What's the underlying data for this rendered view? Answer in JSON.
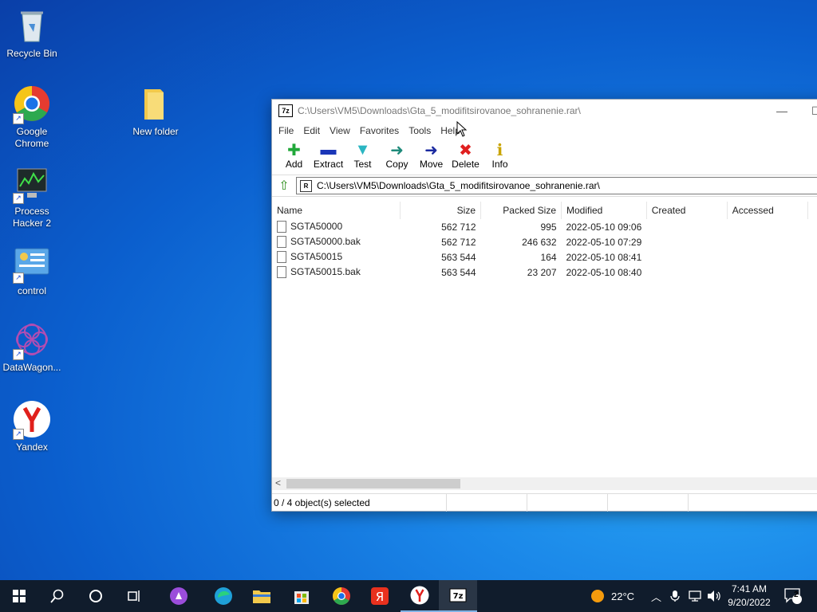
{
  "desktop": {
    "icons": [
      {
        "label": "Recycle Bin"
      },
      {
        "label": "Google Chrome"
      },
      {
        "label": "New folder"
      },
      {
        "label": "Process Hacker 2"
      },
      {
        "label": "control"
      },
      {
        "label": "DataWagon..."
      },
      {
        "label": "Yandex"
      }
    ]
  },
  "window": {
    "app_icon_text": "7z",
    "title": "C:\\Users\\VM5\\Downloads\\Gta_5_modifitsirovanoe_sohranenie.rar\\",
    "menu": [
      "File",
      "Edit",
      "View",
      "Favorites",
      "Tools",
      "Help"
    ],
    "toolbar": [
      {
        "label": "Add",
        "icon": "plus-icon",
        "glyph": "✚",
        "color": "#21a83a"
      },
      {
        "label": "Extract",
        "icon": "minus-icon",
        "glyph": "▬",
        "color": "#1a36b8"
      },
      {
        "label": "Test",
        "icon": "check-icon",
        "glyph": "▼",
        "color": "#2bb6c2"
      },
      {
        "label": "Copy",
        "icon": "copy-arrow-icon",
        "glyph": "➜",
        "color": "#1e8a7a"
      },
      {
        "label": "Move",
        "icon": "move-arrow-icon",
        "glyph": "➜",
        "color": "#1b2aa0"
      },
      {
        "label": "Delete",
        "icon": "delete-x-icon",
        "glyph": "✖",
        "color": "#e02020"
      },
      {
        "label": "Info",
        "icon": "info-icon",
        "glyph": "ℹ",
        "color": "#c9a400"
      }
    ],
    "address": "C:\\Users\\VM5\\Downloads\\Gta_5_modifitsirovanoe_sohranenie.rar\\",
    "columns": [
      "Name",
      "Size",
      "Packed Size",
      "Modified",
      "Created",
      "Accessed"
    ],
    "rows": [
      {
        "name": "SGTA50000",
        "size": "562 712",
        "packed": "995",
        "modified": "2022-05-10 09:06"
      },
      {
        "name": "SGTA50000.bak",
        "size": "562 712",
        "packed": "246 632",
        "modified": "2022-05-10 07:29"
      },
      {
        "name": "SGTA50015",
        "size": "563 544",
        "packed": "164",
        "modified": "2022-05-10 08:41"
      },
      {
        "name": "SGTA50015.bak",
        "size": "563 544",
        "packed": "23 207",
        "modified": "2022-05-10 08:40"
      }
    ],
    "status": "0 / 4 object(s) selected"
  },
  "taskbar": {
    "weather": "22°C",
    "time": "7:41 AM",
    "date": "9/20/2022",
    "notifications": "2"
  },
  "colors": {
    "taskbar_bg": "#101c2c",
    "desktop_blue": "#1a86e8"
  }
}
